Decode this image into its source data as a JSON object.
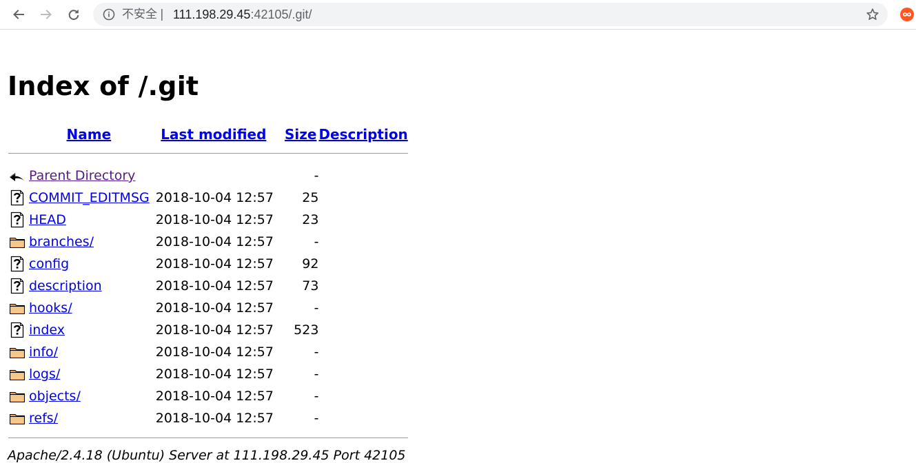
{
  "browser": {
    "omnibox": {
      "security_label": "不安全",
      "separator": "|",
      "url_host": "111.198.29.45",
      "url_rest": ":42105/.git/"
    },
    "icons": {
      "back": "arrow-left-icon",
      "forward": "arrow-right-icon",
      "reload": "reload-icon",
      "info": "info-circle-icon",
      "star": "star-icon",
      "extension": "extension-icon"
    }
  },
  "page": {
    "title": "Index of /.git",
    "columns": {
      "name": "Name",
      "last_modified": "Last modified",
      "size": "Size",
      "description": "Description"
    },
    "rows": [
      {
        "icon": "back-arrow-icon",
        "name": "Parent Directory",
        "modified": "",
        "size": "-"
      },
      {
        "icon": "unknown-file-icon",
        "name": "COMMIT_EDITMSG",
        "modified": "2018-10-04 12:57",
        "size": "25"
      },
      {
        "icon": "unknown-file-icon",
        "name": "HEAD",
        "modified": "2018-10-04 12:57",
        "size": "23"
      },
      {
        "icon": "folder-icon",
        "name": "branches/",
        "modified": "2018-10-04 12:57",
        "size": "-"
      },
      {
        "icon": "unknown-file-icon",
        "name": "config",
        "modified": "2018-10-04 12:57",
        "size": "92"
      },
      {
        "icon": "unknown-file-icon",
        "name": "description",
        "modified": "2018-10-04 12:57",
        "size": "73"
      },
      {
        "icon": "folder-icon",
        "name": "hooks/",
        "modified": "2018-10-04 12:57",
        "size": "-"
      },
      {
        "icon": "unknown-file-icon",
        "name": "index",
        "modified": "2018-10-04 12:57",
        "size": "523"
      },
      {
        "icon": "folder-icon",
        "name": "info/",
        "modified": "2018-10-04 12:57",
        "size": "-"
      },
      {
        "icon": "folder-icon",
        "name": "logs/",
        "modified": "2018-10-04 12:57",
        "size": "-"
      },
      {
        "icon": "folder-icon",
        "name": "objects/",
        "modified": "2018-10-04 12:57",
        "size": "-"
      },
      {
        "icon": "folder-icon",
        "name": "refs/",
        "modified": "2018-10-04 12:57",
        "size": "-"
      }
    ],
    "footer": "Apache/2.4.18 (Ubuntu) Server at 111.198.29.45 Port 42105"
  },
  "colors": {
    "link": "#0000ee",
    "visited": "#551a8b",
    "omnibox_bg": "#f1f3f4",
    "extension": "#ff5722"
  }
}
